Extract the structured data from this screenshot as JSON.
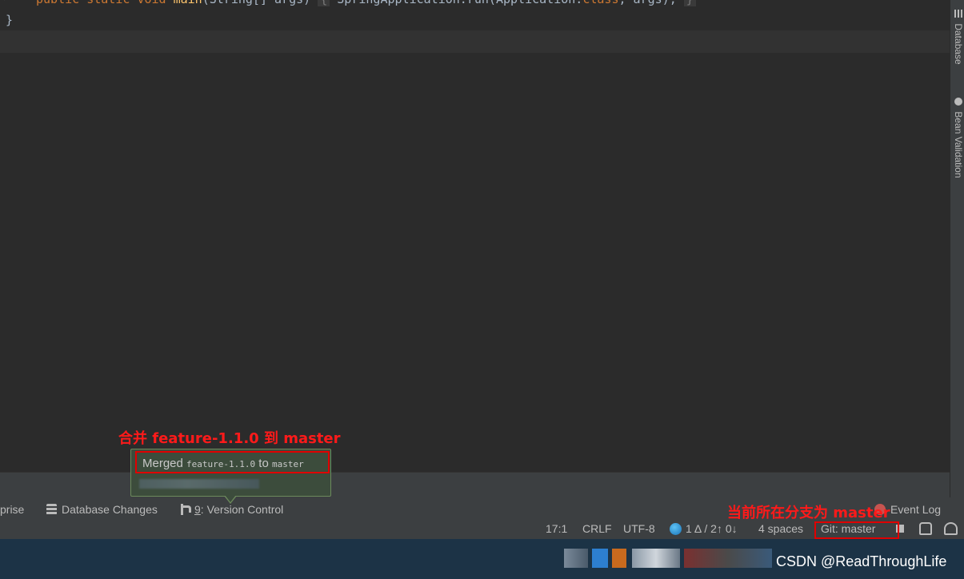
{
  "editor": {
    "code_line_1": {
      "kw1": "public",
      "kw2": "static",
      "kw3": "void",
      "fn": "main",
      "params": "(String[] args)",
      "body_open": "{",
      "call": "SpringApplication.run(Application.",
      "cls": "class",
      "args": ", args);",
      "body_close": "}"
    },
    "closing_brace": "}"
  },
  "right_tool_windows": [
    {
      "label": "Database"
    },
    {
      "label": "Bean Validation"
    }
  ],
  "tool_window_bar": {
    "enterprise": "prise",
    "database_changes": "Database Changes",
    "version_control_num": "9",
    "version_control_label": ": Version Control",
    "event_log": "Event Log"
  },
  "notification": {
    "prefix": "Merged ",
    "source_branch": "feature-1.1.0",
    "middle": " to ",
    "target_branch": "master"
  },
  "status_bar": {
    "position": "17:1",
    "line_separator": "CRLF",
    "encoding": "UTF-8",
    "vcs_changes": "1 Δ / 2↑ 0↓",
    "indent": "4 spaces",
    "git_branch": "Git: master"
  },
  "annotations": {
    "merge": "合并 feature-1.1.0 到 master",
    "current_branch": "当前所在分支为 master"
  },
  "watermark": "CSDN @ReadThroughLife",
  "colors": {
    "editor_bg": "#2b2b2b",
    "panel_bg": "#3c3f41",
    "annotation_red": "#ff1a1a",
    "notification_bg": "#3c4c3c"
  }
}
